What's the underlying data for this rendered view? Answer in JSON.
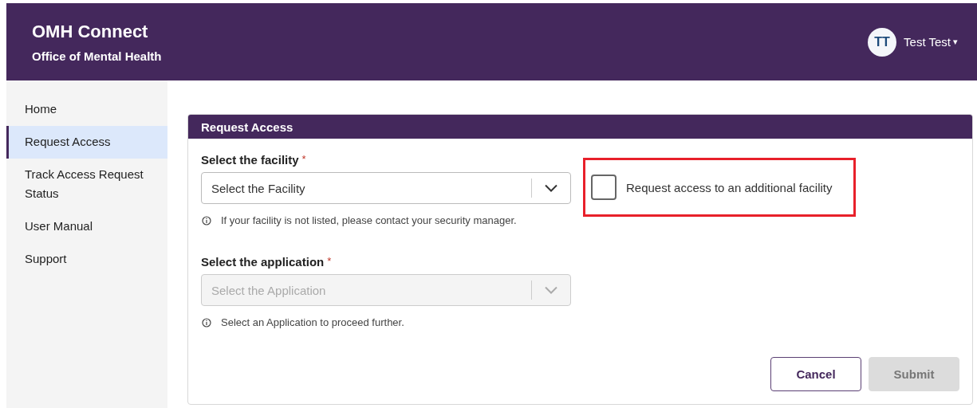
{
  "header": {
    "title": "OMH Connect",
    "subtitle": "Office of Mental Health"
  },
  "user": {
    "initials": "TT",
    "name": "Test Test",
    "caret": "▾"
  },
  "sidebar": {
    "items": [
      {
        "label": "Home",
        "selected": false
      },
      {
        "label": "Request Access",
        "selected": true
      },
      {
        "label": "Track Access Request Status",
        "selected": false
      },
      {
        "label": "User Manual",
        "selected": false
      },
      {
        "label": "Support",
        "selected": false
      }
    ]
  },
  "card": {
    "title": "Request Access",
    "fields": [
      {
        "label": "Select the facility",
        "required": "*",
        "placeholder": "Select the Facility",
        "disabled": false,
        "help": "If your facility is not listed, please contact your security manager."
      },
      {
        "label": "Select the application",
        "required": "*",
        "placeholder": "Select the Application",
        "disabled": true,
        "help": "Select an Application to proceed further."
      }
    ],
    "checkbox": {
      "label": "Request access to an additional facility",
      "checked": false,
      "highlighted": true
    },
    "buttons": [
      {
        "label": "Cancel",
        "kind": "secondary",
        "disabled": false
      },
      {
        "label": "Submit",
        "kind": "primary",
        "disabled": true
      }
    ]
  }
}
